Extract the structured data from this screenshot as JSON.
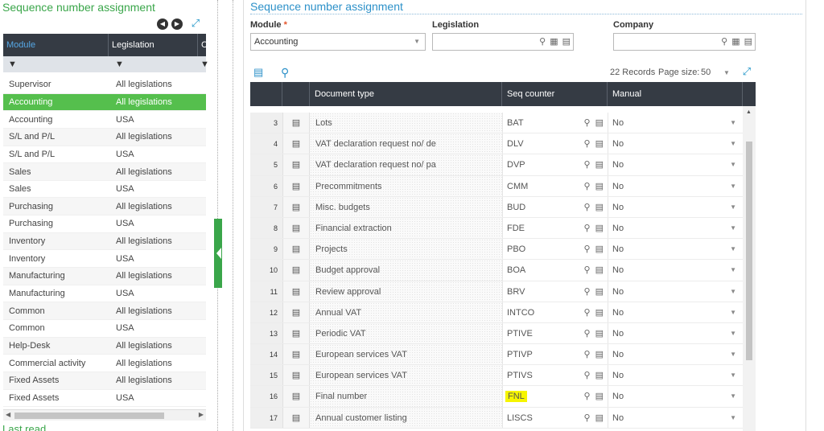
{
  "left_panel": {
    "title": "Sequence number assignment",
    "columns": [
      "Module",
      "Legislation",
      "C"
    ],
    "rows": [
      {
        "module": "Supervisor",
        "legislation": "All legislations"
      },
      {
        "module": "Accounting",
        "legislation": "All legislations",
        "active": true
      },
      {
        "module": "Accounting",
        "legislation": "USA"
      },
      {
        "module": "S/L and P/L",
        "legislation": "All legislations"
      },
      {
        "module": "S/L and P/L",
        "legislation": "USA"
      },
      {
        "module": "Sales",
        "legislation": "All legislations"
      },
      {
        "module": "Sales",
        "legislation": "USA"
      },
      {
        "module": "Purchasing",
        "legislation": "All legislations"
      },
      {
        "module": "Purchasing",
        "legislation": "USA"
      },
      {
        "module": "Inventory",
        "legislation": "All legislations"
      },
      {
        "module": "Inventory",
        "legislation": "USA"
      },
      {
        "module": "Manufacturing",
        "legislation": "All legislations"
      },
      {
        "module": "Manufacturing",
        "legislation": "USA"
      },
      {
        "module": "Common",
        "legislation": "All legislations"
      },
      {
        "module": "Common",
        "legislation": "USA"
      },
      {
        "module": "Help-Desk",
        "legislation": "All legislations"
      },
      {
        "module": "Commercial activity",
        "legislation": "All legislations"
      },
      {
        "module": "Fixed Assets",
        "legislation": "All legislations"
      },
      {
        "module": "Fixed Assets",
        "legislation": "USA"
      }
    ],
    "footer": "Last read"
  },
  "right_panel": {
    "title": "Sequence number assignment",
    "fields": {
      "module_label": "Module",
      "module_required": "*",
      "module_value": "Accounting",
      "legislation_label": "Legislation",
      "legislation_value": "",
      "company_label": "Company",
      "company_value": ""
    },
    "records": "22 Records",
    "page_size_label": "Page size:",
    "page_size": "50",
    "columns": [
      "Document type",
      "Seq counter",
      "Manual"
    ],
    "rows": [
      {
        "n": "3",
        "doc": "Lots",
        "seq": "BAT",
        "manual": "No"
      },
      {
        "n": "4",
        "doc": "VAT declaration request no/ de",
        "seq": "DLV",
        "manual": "No"
      },
      {
        "n": "5",
        "doc": "VAT declaration request no/ pa",
        "seq": "DVP",
        "manual": "No"
      },
      {
        "n": "6",
        "doc": "Precommitments",
        "seq": "CMM",
        "manual": "No"
      },
      {
        "n": "7",
        "doc": "Misc. budgets",
        "seq": "BUD",
        "manual": "No"
      },
      {
        "n": "8",
        "doc": "Financial extraction",
        "seq": "FDE",
        "manual": "No"
      },
      {
        "n": "9",
        "doc": "Projects",
        "seq": "PBO",
        "manual": "No"
      },
      {
        "n": "10",
        "doc": "Budget approval",
        "seq": "BOA",
        "manual": "No"
      },
      {
        "n": "11",
        "doc": "Review approval",
        "seq": "BRV",
        "manual": "No"
      },
      {
        "n": "12",
        "doc": "Annual VAT",
        "seq": "INTCO",
        "manual": "No"
      },
      {
        "n": "13",
        "doc": "Periodic VAT",
        "seq": "PTIVE",
        "manual": "No"
      },
      {
        "n": "14",
        "doc": "European services VAT",
        "seq": "PTIVP",
        "manual": "No"
      },
      {
        "n": "15",
        "doc": "European services VAT",
        "seq": "PTIVS",
        "manual": "No"
      },
      {
        "n": "16",
        "doc": "Final number",
        "seq": "FNL",
        "manual": "No",
        "highlight": true
      },
      {
        "n": "17",
        "doc": "Annual customer listing",
        "seq": "LISCS",
        "manual": "No"
      }
    ]
  },
  "colors": {
    "accent_green": "#3aa64a",
    "accent_blue": "#2d91c9",
    "header_dark": "#353b44",
    "active_row": "#55bf4d",
    "highlight": "#f6f500"
  }
}
